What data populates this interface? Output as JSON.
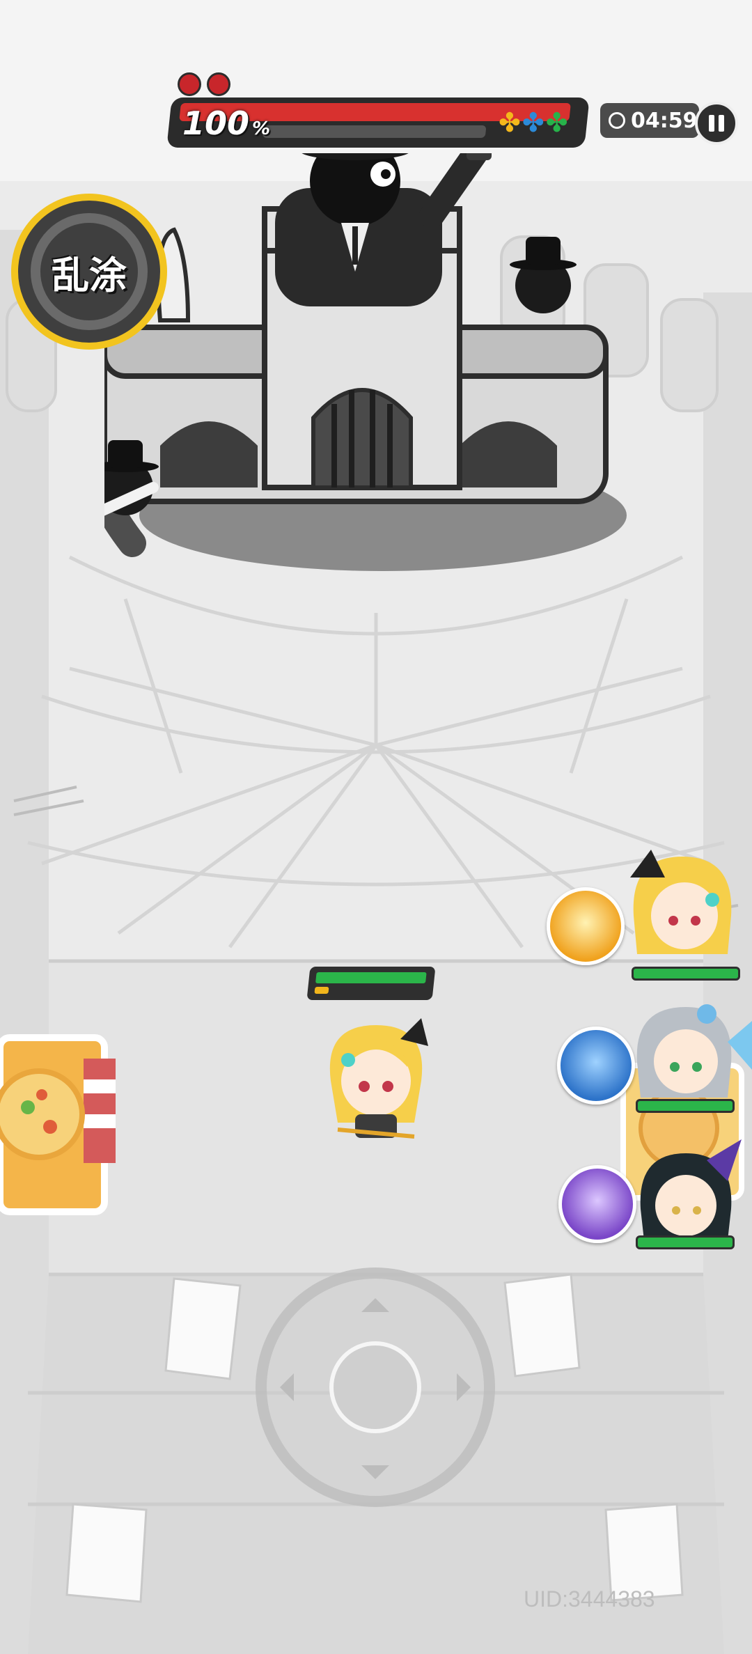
{
  "hud": {
    "boss_hp_percent": 100,
    "boss_hp_value": "100",
    "boss_hp_unit": "%",
    "boss_phase_pips": 2,
    "weakness_icons": [
      "yellow-clover-icon",
      "blue-clover-icon",
      "green-clover-icon"
    ],
    "timer": "04:59"
  },
  "mode_badge": {
    "label": "乱涂"
  },
  "player": {
    "hp_fraction": 0.95,
    "energy_fraction": 0.12
  },
  "team": [
    {
      "name": "blonde-girl-with-bow",
      "skill_icon": "gold-flame-skill-icon",
      "skill_color": "#f0a21e",
      "hp_fraction": 1.0
    },
    {
      "name": "silver-hair-girl-with-headphones",
      "skill_icon": "blue-bird-skill-icon",
      "skill_color": "#2d73c9",
      "hp_fraction": 1.0
    },
    {
      "name": "dark-hair-girl-with-horns",
      "skill_icon": "purple-swirl-skill-icon",
      "skill_color": "#7a46c8",
      "hp_fraction": 1.0
    }
  ],
  "footer": {
    "uid": "UID:3444383"
  }
}
